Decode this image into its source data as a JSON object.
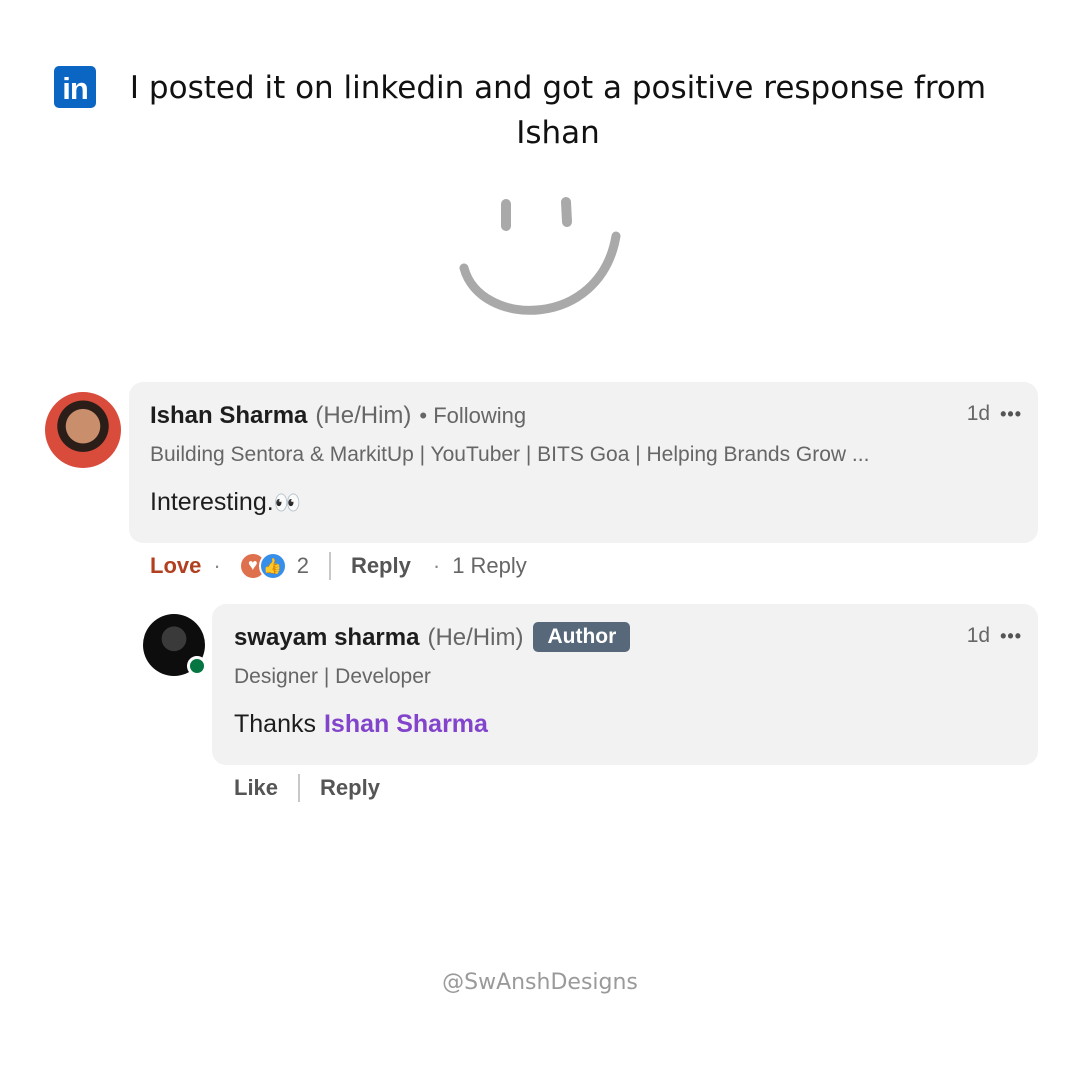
{
  "header": {
    "logo_text": "in",
    "title": "I posted it on linkedin and got a positive response from Ishan"
  },
  "comment": {
    "author": "Ishan Sharma",
    "pronouns": "(He/Him)",
    "follow_status": "• Following",
    "headline": "Building Sentora & MarkitUp | YouTuber | BITS Goa | Helping Brands Grow ...",
    "text": "Interesting.",
    "emoji": "👀",
    "time": "1d",
    "more": "•••",
    "actions": {
      "love_label": "Love",
      "dot": "·",
      "reaction_count": "2",
      "reply_label": "Reply",
      "replies_count": "1 Reply"
    },
    "reaction_icons": [
      "heart-reaction-icon",
      "like-reaction-icon"
    ],
    "colors": {
      "love": "#b24020",
      "heart": "#df704d",
      "like": "#378fe9"
    }
  },
  "reply": {
    "author": "swayam sharma",
    "pronouns": "(He/Him)",
    "badge": "Author",
    "headline": "Designer | Developer",
    "text_prefix": "Thanks",
    "mention": "Ishan Sharma",
    "time": "1d",
    "more": "•••",
    "actions": {
      "like_label": "Like",
      "reply_label": "Reply"
    },
    "colors": {
      "mention": "#8344cc",
      "online": "#057642",
      "badge": "#56687a"
    }
  },
  "watermark": "@SwAnshDesigns",
  "colors": {
    "linkedin_blue": "#0a66c2",
    "bubble": "#f2f2f2"
  }
}
